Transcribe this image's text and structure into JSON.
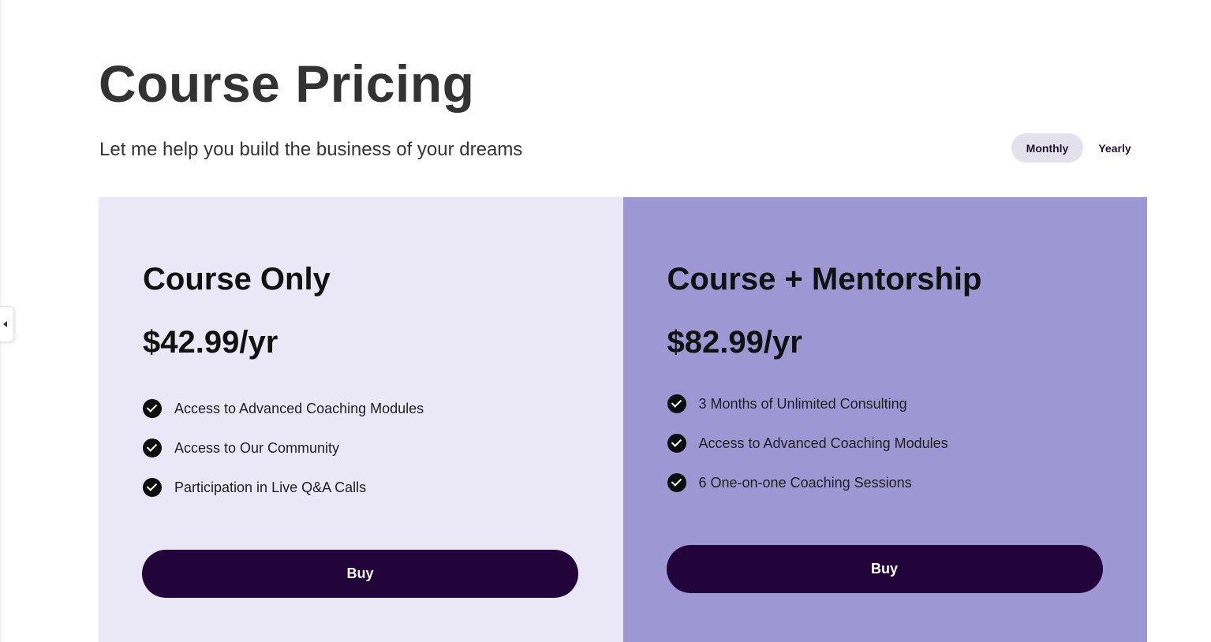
{
  "header": {
    "title": "Course Pricing",
    "subtitle": "Let me help you build the business of your dreams"
  },
  "billing_toggle": {
    "options": [
      "Monthly",
      "Yearly"
    ],
    "selected": "Monthly"
  },
  "plans": [
    {
      "name": "Course Only",
      "price": "$42.99/yr",
      "features": [
        "Access to Advanced Coaching Modules",
        "Access to Our Community",
        "Participation in Live Q&A Calls"
      ],
      "button_label": "Buy",
      "background": "#eae8f6"
    },
    {
      "name": "Course + Mentorship",
      "price": "$82.99/yr",
      "features": [
        "3 Months of Unlimited Consulting",
        "Access to Advanced Coaching Modules",
        "6 One-on-one Coaching Sessions"
      ],
      "button_label": "Buy",
      "background": "#9d98d4"
    }
  ],
  "colors": {
    "button": "#22033a",
    "toggle_active": "#e3e1eb",
    "heading": "#333333"
  }
}
